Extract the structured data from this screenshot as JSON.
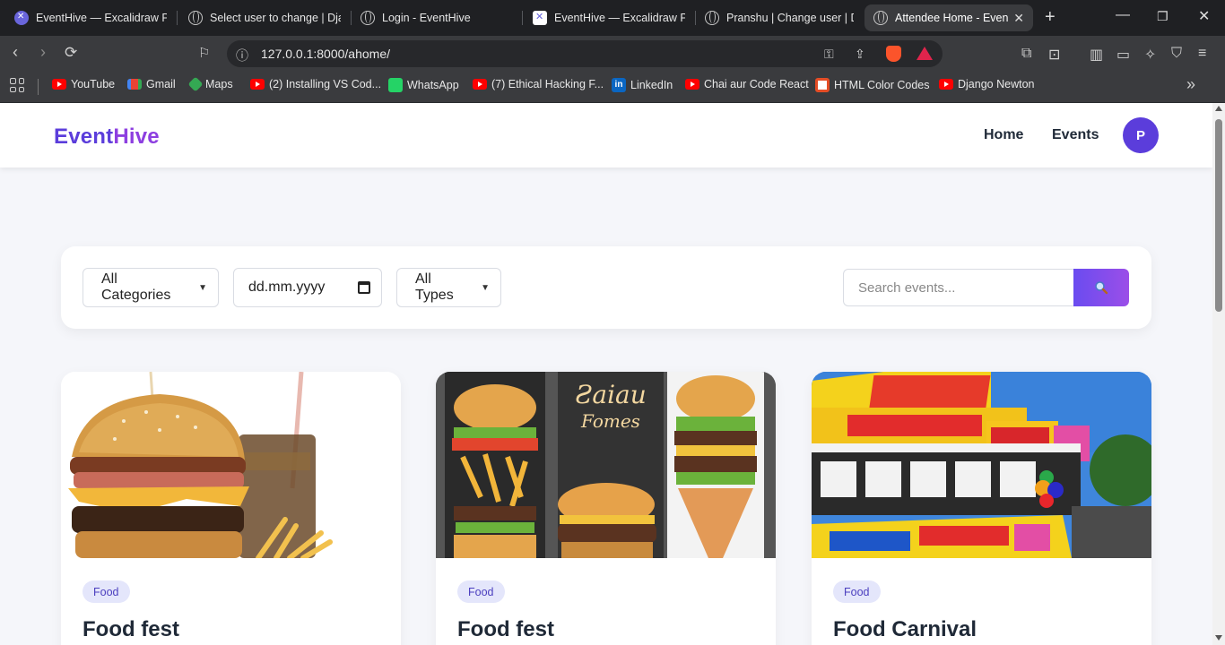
{
  "browser": {
    "tabs": [
      {
        "title": "EventHive — Excalidraw Plu",
        "icon": "excalidraw-icon"
      },
      {
        "title": "Select user to change | Dja",
        "icon": "globe-icon"
      },
      {
        "title": "Login - EventHive",
        "icon": "globe-icon"
      },
      {
        "title": "EventHive — Excalidraw Plu",
        "icon": "excalidraw-icon"
      },
      {
        "title": "Pranshu | Change user | Dja",
        "icon": "globe-icon"
      },
      {
        "title": "Attendee Home - Even",
        "icon": "globe-icon",
        "active": true
      }
    ],
    "url": "127.0.0.1:8000/ahome/",
    "bookmarks": [
      {
        "label": "YouTube",
        "icon": "youtube-icon"
      },
      {
        "label": "Gmail",
        "icon": "gmail-icon"
      },
      {
        "label": "Maps",
        "icon": "maps-icon"
      },
      {
        "label": "(2) Installing VS Cod...",
        "icon": "youtube-icon"
      },
      {
        "label": "WhatsApp",
        "icon": "whatsapp-icon"
      },
      {
        "label": "(7) Ethical Hacking F...",
        "icon": "youtube-icon"
      },
      {
        "label": "LinkedIn",
        "icon": "linkedin-icon"
      },
      {
        "label": "Chai aur Code React",
        "icon": "youtube-icon"
      },
      {
        "label": "HTML Color Codes",
        "icon": "htmlcolor-icon"
      },
      {
        "label": "Django Newton",
        "icon": "youtube-icon"
      }
    ]
  },
  "site": {
    "logo_part1": "Event",
    "logo_part2": "Hive",
    "nav": {
      "home": "Home",
      "events": "Events"
    },
    "avatar_letter": "P"
  },
  "filters": {
    "category": "All Categories",
    "date_placeholder": "dd.mm.yyyy",
    "type": "All Types",
    "search_placeholder": "Search events..."
  },
  "events": [
    {
      "category": "Food",
      "title": "Food fest"
    },
    {
      "category": "Food",
      "title": "Food fest"
    },
    {
      "category": "Food",
      "title": "Food Carnival"
    }
  ],
  "colors": {
    "brand": "#5b3ddb",
    "brand2": "#8d3fe0",
    "badge_bg": "#e4e6fb",
    "page_bg": "#f5f6fa"
  }
}
